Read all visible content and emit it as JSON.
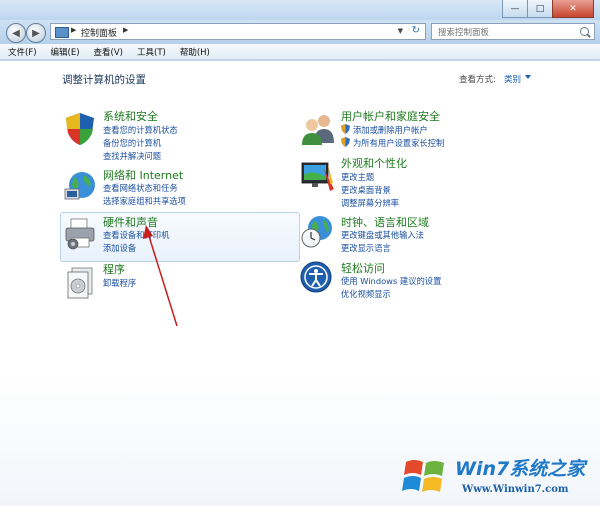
{
  "window": {
    "address": {
      "segment": "控制面板",
      "separator": "▶"
    },
    "search_placeholder": "搜索控制面板",
    "buttons": {
      "minimize": "—",
      "maximize": "□",
      "close": "✕"
    }
  },
  "menu": [
    "文件(F)",
    "编辑(E)",
    "查看(V)",
    "工具(T)",
    "帮助(H)"
  ],
  "content": {
    "heading": "调整计算机的设置",
    "view_by_label": "查看方式:",
    "view_by_value": "类别"
  },
  "categories_left": [
    {
      "title": "系统和安全",
      "links": [
        "查看您的计算机状态",
        "备份您的计算机",
        "查找并解决问题"
      ]
    },
    {
      "title": "网络和 Internet",
      "links": [
        "查看网络状态和任务",
        "选择家庭组和共享选项"
      ]
    },
    {
      "title": "硬件和声音",
      "links": [
        "查看设备和打印机",
        "添加设备"
      ]
    },
    {
      "title": "程序",
      "links": [
        "卸载程序"
      ]
    }
  ],
  "categories_right": [
    {
      "title": "用户帐户和家庭安全",
      "links": [
        "添加或删除用户帐户",
        "为所有用户设置家长控制"
      ]
    },
    {
      "title": "外观和个性化",
      "links": [
        "更改主题",
        "更改桌面背景",
        "调整屏幕分辨率"
      ]
    },
    {
      "title": "时钟、语言和区域",
      "links": [
        "更改键盘或其他输入法",
        "更改显示语言"
      ]
    },
    {
      "title": "轻松访问",
      "links": [
        "使用 Windows 建议的设置",
        "优化视频显示"
      ]
    }
  ],
  "watermark": {
    "title": "Win7系统之家",
    "url": "Www.Winwin7.com"
  }
}
